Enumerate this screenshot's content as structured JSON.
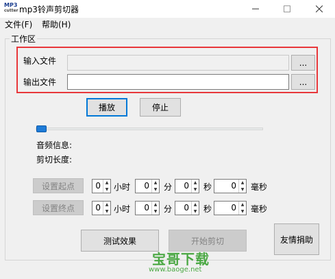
{
  "window": {
    "title": "mp3铃声剪切器",
    "icon_text": "MP3",
    "icon_subtext": "cutter"
  },
  "menu": [
    {
      "label": "文件(F)"
    },
    {
      "label": "帮助(H)"
    }
  ],
  "workarea": {
    "title": "工作区"
  },
  "input_file": {
    "label": "输入文件",
    "value": "",
    "browse": "..."
  },
  "output_file": {
    "label": "输出文件",
    "value": "",
    "browse": "..."
  },
  "playback": {
    "play": "播放",
    "stop": "停止",
    "position": 0
  },
  "info": {
    "audio_info": "音频信息:",
    "cut_length": "剪切长度:"
  },
  "start_row": {
    "button": "设置起点",
    "hours": "0",
    "hour_unit": "小时",
    "minutes": "0",
    "minute_unit": "分",
    "seconds": "0",
    "second_unit": "秒",
    "ms": "0",
    "ms_unit": "毫秒"
  },
  "end_row": {
    "button": "设置终点",
    "hours": "0",
    "hour_unit": "小时",
    "minutes": "0",
    "minute_unit": "分",
    "seconds": "0",
    "second_unit": "秒",
    "ms": "0",
    "ms_unit": "毫秒"
  },
  "actions": {
    "test": "测试效果",
    "start_cut": "开始剪切",
    "donate": "友情捐助"
  },
  "watermark": {
    "brand": "宝哥下载",
    "url": "www.baoge.net"
  },
  "colors": {
    "highlight_box": "#e8373a",
    "slider_thumb": "#1e7bd7",
    "watermark": "#4aa843"
  }
}
